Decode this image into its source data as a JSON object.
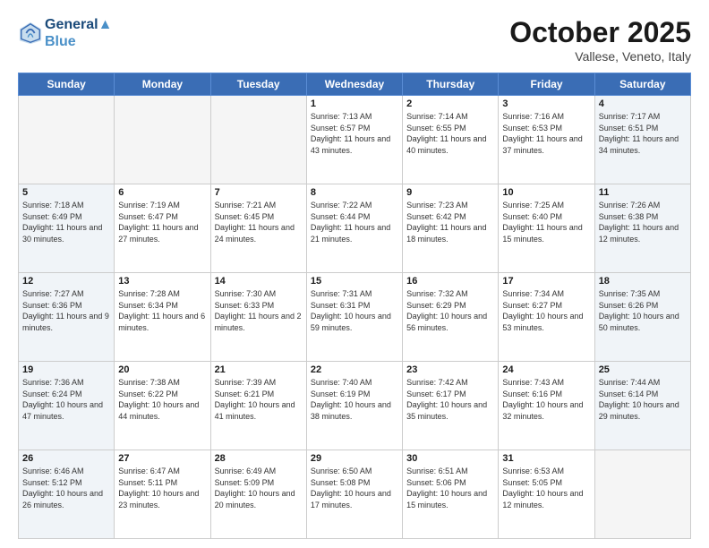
{
  "header": {
    "logo_line1": "General",
    "logo_line2": "Blue",
    "month": "October 2025",
    "location": "Vallese, Veneto, Italy"
  },
  "weekdays": [
    "Sunday",
    "Monday",
    "Tuesday",
    "Wednesday",
    "Thursday",
    "Friday",
    "Saturday"
  ],
  "weeks": [
    [
      {
        "day": "",
        "empty": true
      },
      {
        "day": "",
        "empty": true
      },
      {
        "day": "",
        "empty": true
      },
      {
        "day": "1",
        "sunrise": "7:13 AM",
        "sunset": "6:57 PM",
        "daylight": "11 hours and 43 minutes."
      },
      {
        "day": "2",
        "sunrise": "7:14 AM",
        "sunset": "6:55 PM",
        "daylight": "11 hours and 40 minutes."
      },
      {
        "day": "3",
        "sunrise": "7:16 AM",
        "sunset": "6:53 PM",
        "daylight": "11 hours and 37 minutes."
      },
      {
        "day": "4",
        "sunrise": "7:17 AM",
        "sunset": "6:51 PM",
        "daylight": "11 hours and 34 minutes."
      }
    ],
    [
      {
        "day": "5",
        "sunrise": "7:18 AM",
        "sunset": "6:49 PM",
        "daylight": "11 hours and 30 minutes."
      },
      {
        "day": "6",
        "sunrise": "7:19 AM",
        "sunset": "6:47 PM",
        "daylight": "11 hours and 27 minutes."
      },
      {
        "day": "7",
        "sunrise": "7:21 AM",
        "sunset": "6:45 PM",
        "daylight": "11 hours and 24 minutes."
      },
      {
        "day": "8",
        "sunrise": "7:22 AM",
        "sunset": "6:44 PM",
        "daylight": "11 hours and 21 minutes."
      },
      {
        "day": "9",
        "sunrise": "7:23 AM",
        "sunset": "6:42 PM",
        "daylight": "11 hours and 18 minutes."
      },
      {
        "day": "10",
        "sunrise": "7:25 AM",
        "sunset": "6:40 PM",
        "daylight": "11 hours and 15 minutes."
      },
      {
        "day": "11",
        "sunrise": "7:26 AM",
        "sunset": "6:38 PM",
        "daylight": "11 hours and 12 minutes."
      }
    ],
    [
      {
        "day": "12",
        "sunrise": "7:27 AM",
        "sunset": "6:36 PM",
        "daylight": "11 hours and 9 minutes."
      },
      {
        "day": "13",
        "sunrise": "7:28 AM",
        "sunset": "6:34 PM",
        "daylight": "11 hours and 6 minutes."
      },
      {
        "day": "14",
        "sunrise": "7:30 AM",
        "sunset": "6:33 PM",
        "daylight": "11 hours and 2 minutes."
      },
      {
        "day": "15",
        "sunrise": "7:31 AM",
        "sunset": "6:31 PM",
        "daylight": "10 hours and 59 minutes."
      },
      {
        "day": "16",
        "sunrise": "7:32 AM",
        "sunset": "6:29 PM",
        "daylight": "10 hours and 56 minutes."
      },
      {
        "day": "17",
        "sunrise": "7:34 AM",
        "sunset": "6:27 PM",
        "daylight": "10 hours and 53 minutes."
      },
      {
        "day": "18",
        "sunrise": "7:35 AM",
        "sunset": "6:26 PM",
        "daylight": "10 hours and 50 minutes."
      }
    ],
    [
      {
        "day": "19",
        "sunrise": "7:36 AM",
        "sunset": "6:24 PM",
        "daylight": "10 hours and 47 minutes."
      },
      {
        "day": "20",
        "sunrise": "7:38 AM",
        "sunset": "6:22 PM",
        "daylight": "10 hours and 44 minutes."
      },
      {
        "day": "21",
        "sunrise": "7:39 AM",
        "sunset": "6:21 PM",
        "daylight": "10 hours and 41 minutes."
      },
      {
        "day": "22",
        "sunrise": "7:40 AM",
        "sunset": "6:19 PM",
        "daylight": "10 hours and 38 minutes."
      },
      {
        "day": "23",
        "sunrise": "7:42 AM",
        "sunset": "6:17 PM",
        "daylight": "10 hours and 35 minutes."
      },
      {
        "day": "24",
        "sunrise": "7:43 AM",
        "sunset": "6:16 PM",
        "daylight": "10 hours and 32 minutes."
      },
      {
        "day": "25",
        "sunrise": "7:44 AM",
        "sunset": "6:14 PM",
        "daylight": "10 hours and 29 minutes."
      }
    ],
    [
      {
        "day": "26",
        "sunrise": "6:46 AM",
        "sunset": "5:12 PM",
        "daylight": "10 hours and 26 minutes."
      },
      {
        "day": "27",
        "sunrise": "6:47 AM",
        "sunset": "5:11 PM",
        "daylight": "10 hours and 23 minutes."
      },
      {
        "day": "28",
        "sunrise": "6:49 AM",
        "sunset": "5:09 PM",
        "daylight": "10 hours and 20 minutes."
      },
      {
        "day": "29",
        "sunrise": "6:50 AM",
        "sunset": "5:08 PM",
        "daylight": "10 hours and 17 minutes."
      },
      {
        "day": "30",
        "sunrise": "6:51 AM",
        "sunset": "5:06 PM",
        "daylight": "10 hours and 15 minutes."
      },
      {
        "day": "31",
        "sunrise": "6:53 AM",
        "sunset": "5:05 PM",
        "daylight": "10 hours and 12 minutes."
      },
      {
        "day": "",
        "empty": true
      }
    ]
  ]
}
